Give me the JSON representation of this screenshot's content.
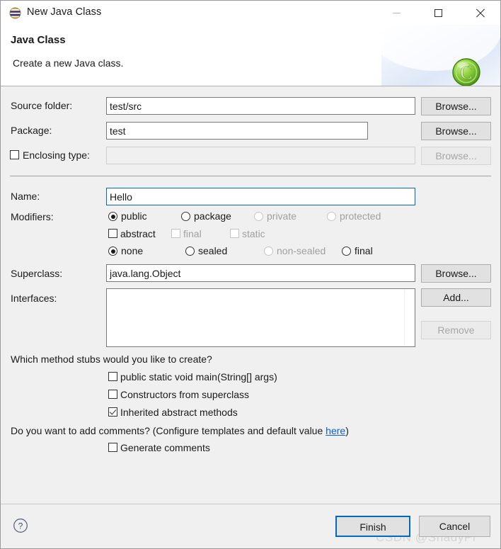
{
  "window": {
    "title": "New Java Class",
    "icon": "eclipse-sphere-icon",
    "minimize_label": "Minimize",
    "maximize_label": "Maximize",
    "close_label": "Close"
  },
  "header": {
    "title": "Java Class",
    "subtitle": "Create a new Java class.",
    "logo": "java-class-green-c-icon"
  },
  "form": {
    "source_folder": {
      "label": "Source folder:",
      "value": "test/src",
      "browse_label": "Browse..."
    },
    "package": {
      "label": "Package:",
      "value": "test",
      "browse_label": "Browse..."
    },
    "enclosing_type": {
      "label": "Enclosing type:",
      "checked": false,
      "value": "",
      "browse_label": "Browse...",
      "disabled": true
    },
    "name": {
      "label": "Name:",
      "value": "Hello"
    },
    "modifiers": {
      "label": "Modifiers:",
      "access": [
        {
          "label": "public",
          "checked": true,
          "disabled": false
        },
        {
          "label": "package",
          "checked": false,
          "disabled": false
        },
        {
          "label": "private",
          "checked": false,
          "disabled": true
        },
        {
          "label": "protected",
          "checked": false,
          "disabled": true
        }
      ],
      "flags": [
        {
          "label": "abstract",
          "checked": false,
          "disabled": false
        },
        {
          "label": "final",
          "checked": false,
          "disabled": true
        },
        {
          "label": "static",
          "checked": false,
          "disabled": true
        }
      ],
      "sealed": [
        {
          "label": "none",
          "checked": true,
          "disabled": false
        },
        {
          "label": "sealed",
          "checked": false,
          "disabled": false
        },
        {
          "label": "non-sealed",
          "checked": false,
          "disabled": true
        },
        {
          "label": "final",
          "checked": false,
          "disabled": false
        }
      ]
    },
    "superclass": {
      "label": "Superclass:",
      "value": "java.lang.Object",
      "browse_label": "Browse..."
    },
    "interfaces": {
      "label": "Interfaces:",
      "items": [],
      "add_label": "Add...",
      "remove_label": "Remove",
      "remove_disabled": true
    }
  },
  "stubs": {
    "question": "Which method stubs would you like to create?",
    "options": [
      {
        "label": "public static void main(String[] args)",
        "checked": false
      },
      {
        "label": "Constructors from superclass",
        "checked": false
      },
      {
        "label": "Inherited abstract methods",
        "checked": true
      }
    ]
  },
  "comments": {
    "question_prefix": "Do you want to add comments? (Configure templates and default value ",
    "link_label": "here",
    "question_suffix": ")",
    "option": {
      "label": "Generate comments",
      "checked": false
    }
  },
  "footer": {
    "help_label": "?",
    "finish_label": "Finish",
    "cancel_label": "Cancel",
    "watermark": "CSDN @ShadyPi"
  },
  "colors": {
    "accent": "#0069c0",
    "link": "#0b5ed7",
    "dialog_bg": "#f0f0f0",
    "logo_green": "#7ac943"
  }
}
